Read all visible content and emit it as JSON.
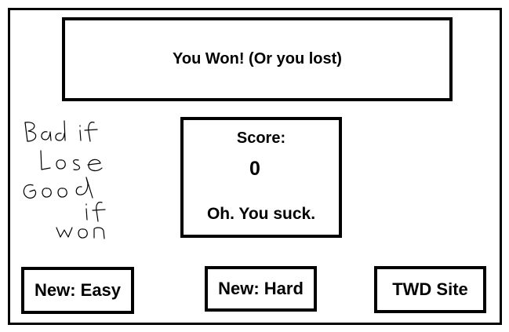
{
  "result": {
    "text": "You Won! (Or you lost)"
  },
  "score": {
    "label": "Score:",
    "value": "0",
    "message": "Oh. You suck."
  },
  "buttons": {
    "easy": "New: Easy",
    "hard": "New: Hard",
    "site": "TWD Site"
  },
  "note": {
    "lines": [
      "Bad if",
      "Lose",
      "Good",
      "if",
      "won"
    ]
  }
}
